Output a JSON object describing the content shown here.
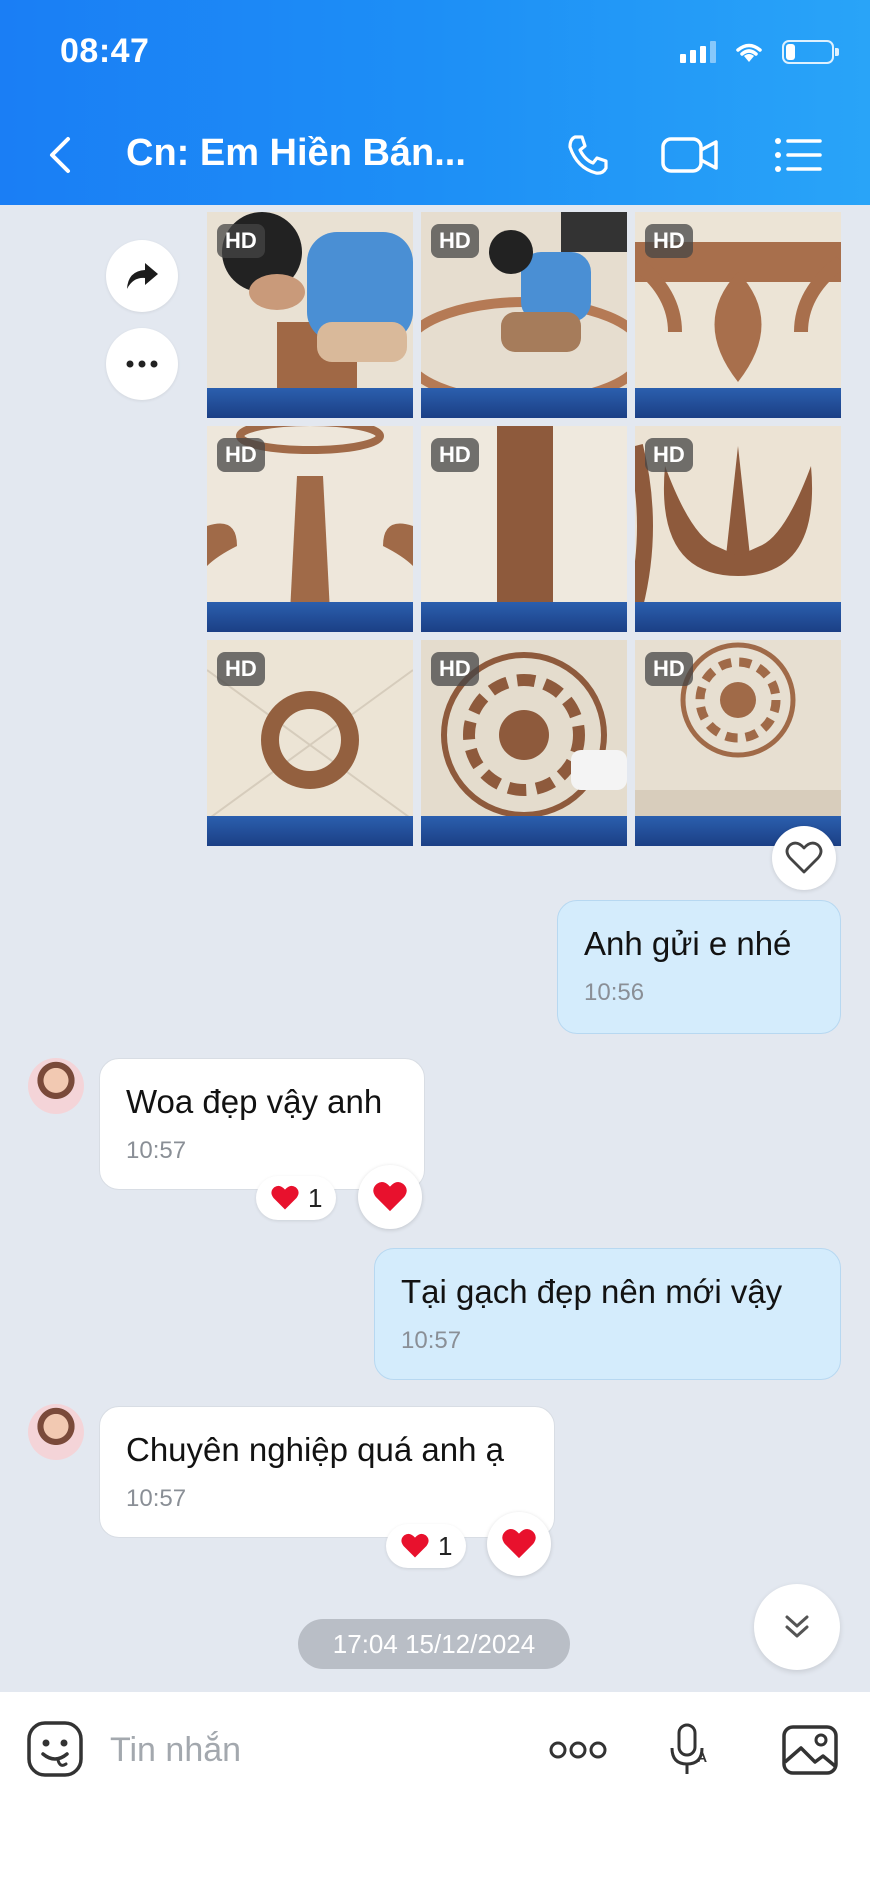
{
  "status_bar": {
    "time": "08:47",
    "battery_level": 0.2
  },
  "header": {
    "title": "Cn: Em Hiền Bán...",
    "back_icon": "chevron-left-icon",
    "call_icon": "phone-icon",
    "video_icon": "video-camera-icon",
    "menu_icon": "list-menu-icon"
  },
  "gallery": {
    "badge": "HD",
    "forward_icon": "share-arrow-icon",
    "more_icon": "more-dots-icon",
    "heart_icon": "heart-outline-icon"
  },
  "messages": [
    {
      "side": "out",
      "text": "Anh gửi e nhé",
      "time": "10:56"
    },
    {
      "side": "in",
      "text": "Woa đẹp vậy anh",
      "time": "10:57",
      "reaction_count": "1"
    },
    {
      "side": "out",
      "text": "Tại gạch đẹp nên mới vậy",
      "time": "10:57"
    },
    {
      "side": "in",
      "text": "Chuyên nghiệp quá anh ạ",
      "time": "10:57",
      "reaction_count": "1"
    }
  ],
  "date_separator": "17:04 15/12/2024",
  "composer": {
    "placeholder": "Tin nhắn",
    "emoji_icon": "emoji-icon",
    "more_icon": "more-dots-icon",
    "mic_icon": "voice-to-text-icon",
    "image_icon": "image-icon"
  },
  "colors": {
    "header_start": "#1a7ef5",
    "header_end": "#29a4f8",
    "outgoing_bubble": "#d4ecfc",
    "incoming_bubble": "#ffffff",
    "background": "#e3e8f0",
    "heart": "#e8112d"
  }
}
